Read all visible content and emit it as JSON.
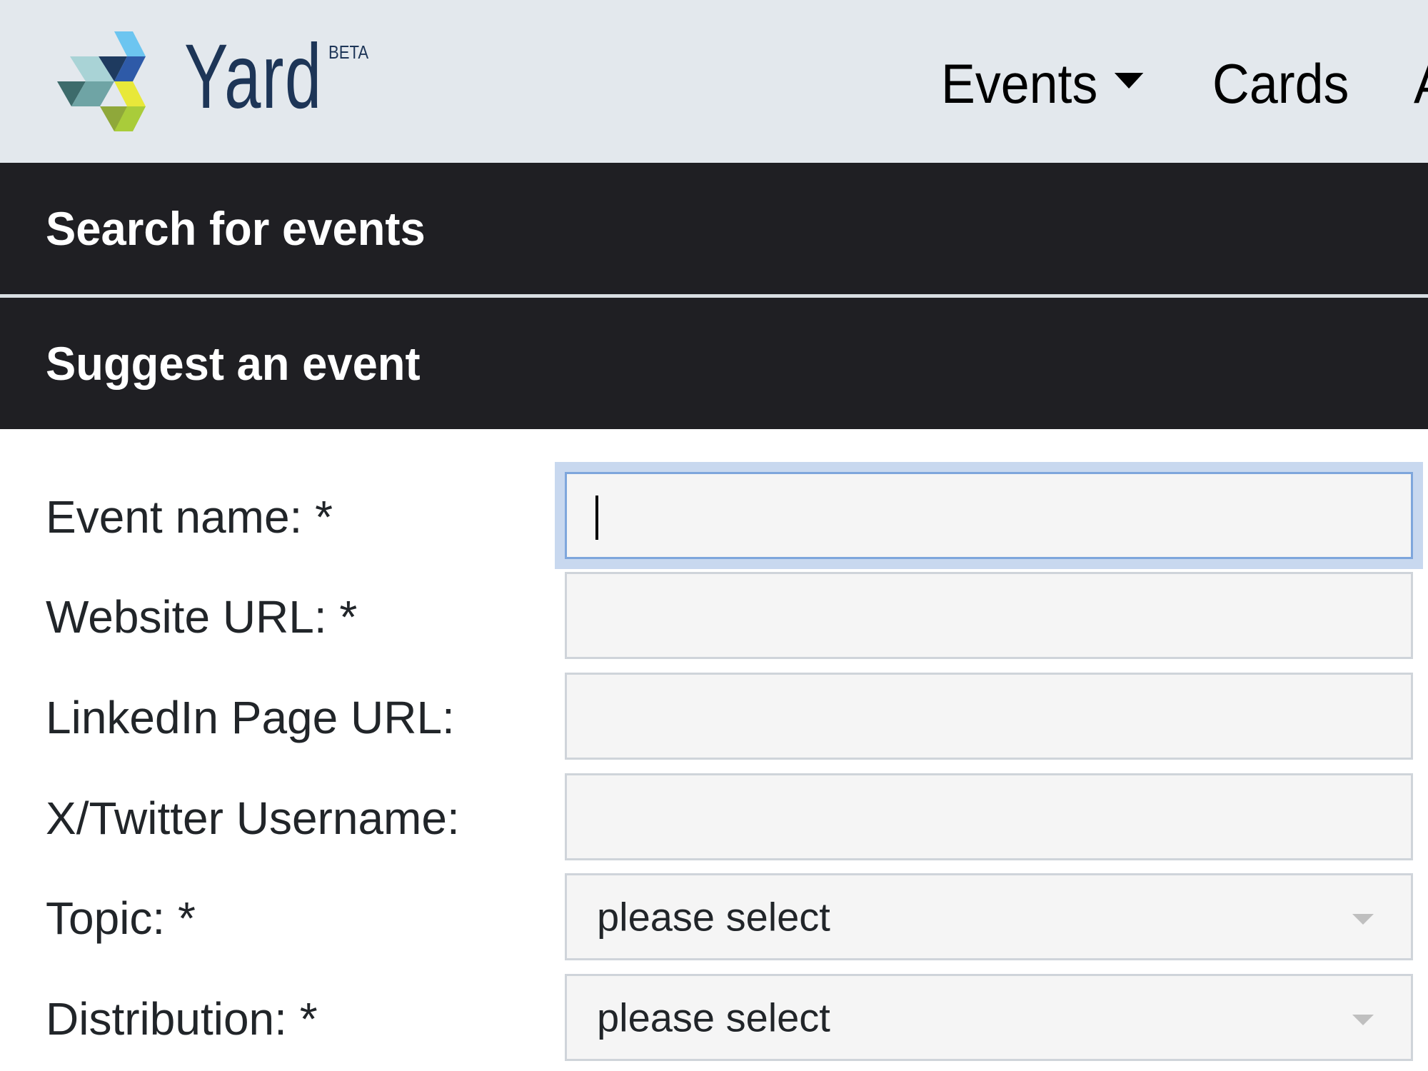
{
  "header": {
    "brand": "Yard",
    "badge": "BETA",
    "nav": [
      {
        "label": "Events",
        "has_dropdown": true
      },
      {
        "label": "Cards",
        "has_dropdown": false
      },
      {
        "label": "A",
        "has_dropdown": false
      }
    ],
    "logo_colors": [
      "#6cc5f0",
      "#2e5aa8",
      "#1e3a5f",
      "#a9d3d6",
      "#6fa4a5",
      "#3d6b6b",
      "#e8e83a",
      "#a9cc3a",
      "#8fa83a"
    ]
  },
  "sections": {
    "search_title": "Search for events",
    "suggest_title": "Suggest an event"
  },
  "form": {
    "fields": [
      {
        "label": "Event name: *",
        "type": "text",
        "value": "",
        "focused": true
      },
      {
        "label": "Website URL: *",
        "type": "text",
        "value": ""
      },
      {
        "label": "LinkedIn Page URL:",
        "type": "text",
        "value": ""
      },
      {
        "label": "X/Twitter Username:",
        "type": "text",
        "value": ""
      },
      {
        "label": "Topic: *",
        "type": "select",
        "value": "please select"
      },
      {
        "label": "Distribution: *",
        "type": "select",
        "value": "please select"
      }
    ]
  },
  "colors": {
    "header_bg": "#e3e8ed",
    "section_bar_bg": "#1f1f23",
    "brand_text": "#1d3557",
    "focus_ring": "#c8d8ef",
    "input_bg": "#f5f5f5"
  }
}
